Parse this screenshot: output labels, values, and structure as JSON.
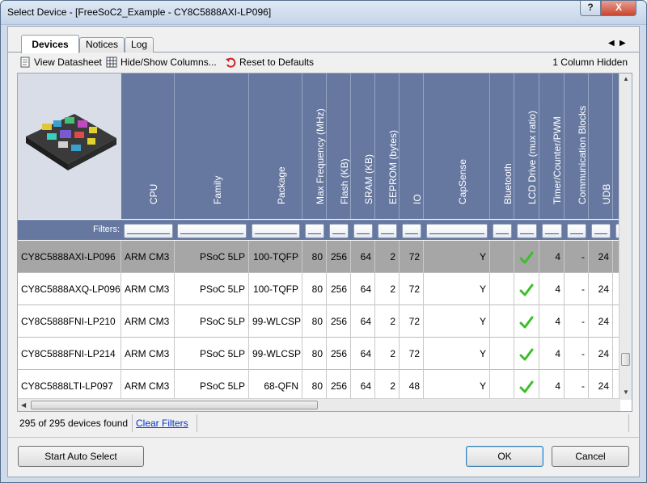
{
  "window": {
    "title": "Select Device - [FreeSoC2_Example - CY8C5888AXI-LP096]",
    "help": "?",
    "close": "X"
  },
  "tabs": [
    {
      "label": "Devices",
      "active": true
    },
    {
      "label": "Notices",
      "active": false
    },
    {
      "label": "Log",
      "active": false
    }
  ],
  "toolbar": {
    "view_datasheet": "View Datasheet",
    "hide_show_columns": "Hide/Show Columns...",
    "reset_defaults": "Reset to Defaults",
    "columns_hidden": "1 Column Hidden"
  },
  "columns": [
    "CPU",
    "Family",
    "Package",
    "Max Frequency (MHz)",
    "Flash (KB)",
    "SRAM (KB)",
    "EEPROM (bytes)",
    "IO",
    "CapSense",
    "Bluetooth",
    "LCD Drive (mux ratio)",
    "Timer/Counter/PWM",
    "Communication Blocks",
    "UDB"
  ],
  "filters_label": "Filters:",
  "rows": [
    {
      "part": "CY8C5888AXI-LP096",
      "cpu": "ARM CM3",
      "family": "PSoC 5LP",
      "package": "100-TQFP",
      "freq": "80",
      "flash": "256",
      "sram": "64",
      "eeprom": "2",
      "io": "72",
      "capsense": "Y",
      "bluetooth": "",
      "lcd": true,
      "timer": "4",
      "comm": "-",
      "udb": "24",
      "selected": true
    },
    {
      "part": "CY8C5888AXQ-LP096",
      "cpu": "ARM CM3",
      "family": "PSoC 5LP",
      "package": "100-TQFP",
      "freq": "80",
      "flash": "256",
      "sram": "64",
      "eeprom": "2",
      "io": "72",
      "capsense": "Y",
      "bluetooth": "",
      "lcd": true,
      "timer": "4",
      "comm": "-",
      "udb": "24",
      "selected": false
    },
    {
      "part": "CY8C5888FNI-LP210",
      "cpu": "ARM CM3",
      "family": "PSoC 5LP",
      "package": "99-WLCSP",
      "freq": "80",
      "flash": "256",
      "sram": "64",
      "eeprom": "2",
      "io": "72",
      "capsense": "Y",
      "bluetooth": "",
      "lcd": true,
      "timer": "4",
      "comm": "-",
      "udb": "24",
      "selected": false
    },
    {
      "part": "CY8C5888FNI-LP214",
      "cpu": "ARM CM3",
      "family": "PSoC 5LP",
      "package": "99-WLCSP",
      "freq": "80",
      "flash": "256",
      "sram": "64",
      "eeprom": "2",
      "io": "72",
      "capsense": "Y",
      "bluetooth": "",
      "lcd": true,
      "timer": "4",
      "comm": "-",
      "udb": "24",
      "selected": false
    },
    {
      "part": "CY8C5888LTI-LP097",
      "cpu": "ARM CM3",
      "family": "PSoC 5LP",
      "package": "68-QFN",
      "freq": "80",
      "flash": "256",
      "sram": "64",
      "eeprom": "2",
      "io": "48",
      "capsense": "Y",
      "bluetooth": "",
      "lcd": true,
      "timer": "4",
      "comm": "-",
      "udb": "24",
      "selected": false
    }
  ],
  "status": {
    "count": "295 of 295 devices found",
    "clear_filters": "Clear Filters"
  },
  "buttons": {
    "auto_select": "Start Auto Select",
    "ok": "OK",
    "cancel": "Cancel"
  },
  "colors": {
    "header_bg": "#6678a0",
    "selected_row": "#a6a6a6",
    "check_green": "#3cbf2a",
    "link": "#0033cc"
  }
}
